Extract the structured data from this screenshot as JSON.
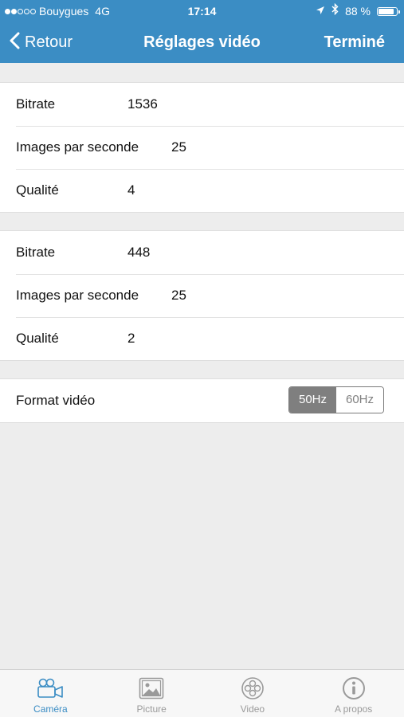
{
  "status_bar": {
    "carrier": "Bouygues",
    "network": "4G",
    "time": "17:14",
    "battery": "88 %",
    "battery_level": 0.88,
    "signal_bars_filled": 2,
    "signal_bars_total": 5
  },
  "nav": {
    "back_label": "Retour",
    "title": "Réglages vidéo",
    "done_label": "Terminé"
  },
  "groups": [
    {
      "rows": [
        {
          "label": "Bitrate",
          "value": "1536"
        },
        {
          "label": "Images par seconde",
          "value": "25"
        },
        {
          "label": "Qualité",
          "value": "4"
        }
      ]
    },
    {
      "rows": [
        {
          "label": "Bitrate",
          "value": "448"
        },
        {
          "label": "Images par seconde",
          "value": "25"
        },
        {
          "label": "Qualité",
          "value": "2"
        }
      ]
    }
  ],
  "format": {
    "label": "Format vidéo",
    "options": [
      "50Hz",
      "60Hz"
    ],
    "selected": "50Hz"
  },
  "tabbar": {
    "items": [
      {
        "label": "Caméra",
        "icon": "camera-icon",
        "active": true
      },
      {
        "label": "Picture",
        "icon": "picture-icon",
        "active": false
      },
      {
        "label": "Video",
        "icon": "video-reel-icon",
        "active": false
      },
      {
        "label": "A propos",
        "icon": "info-icon",
        "active": false
      }
    ]
  },
  "colors": {
    "accent": "#3b8dc4",
    "background": "#ededed",
    "segment_active": "#7f7f7f",
    "tab_inactive": "#9a9a9a"
  }
}
